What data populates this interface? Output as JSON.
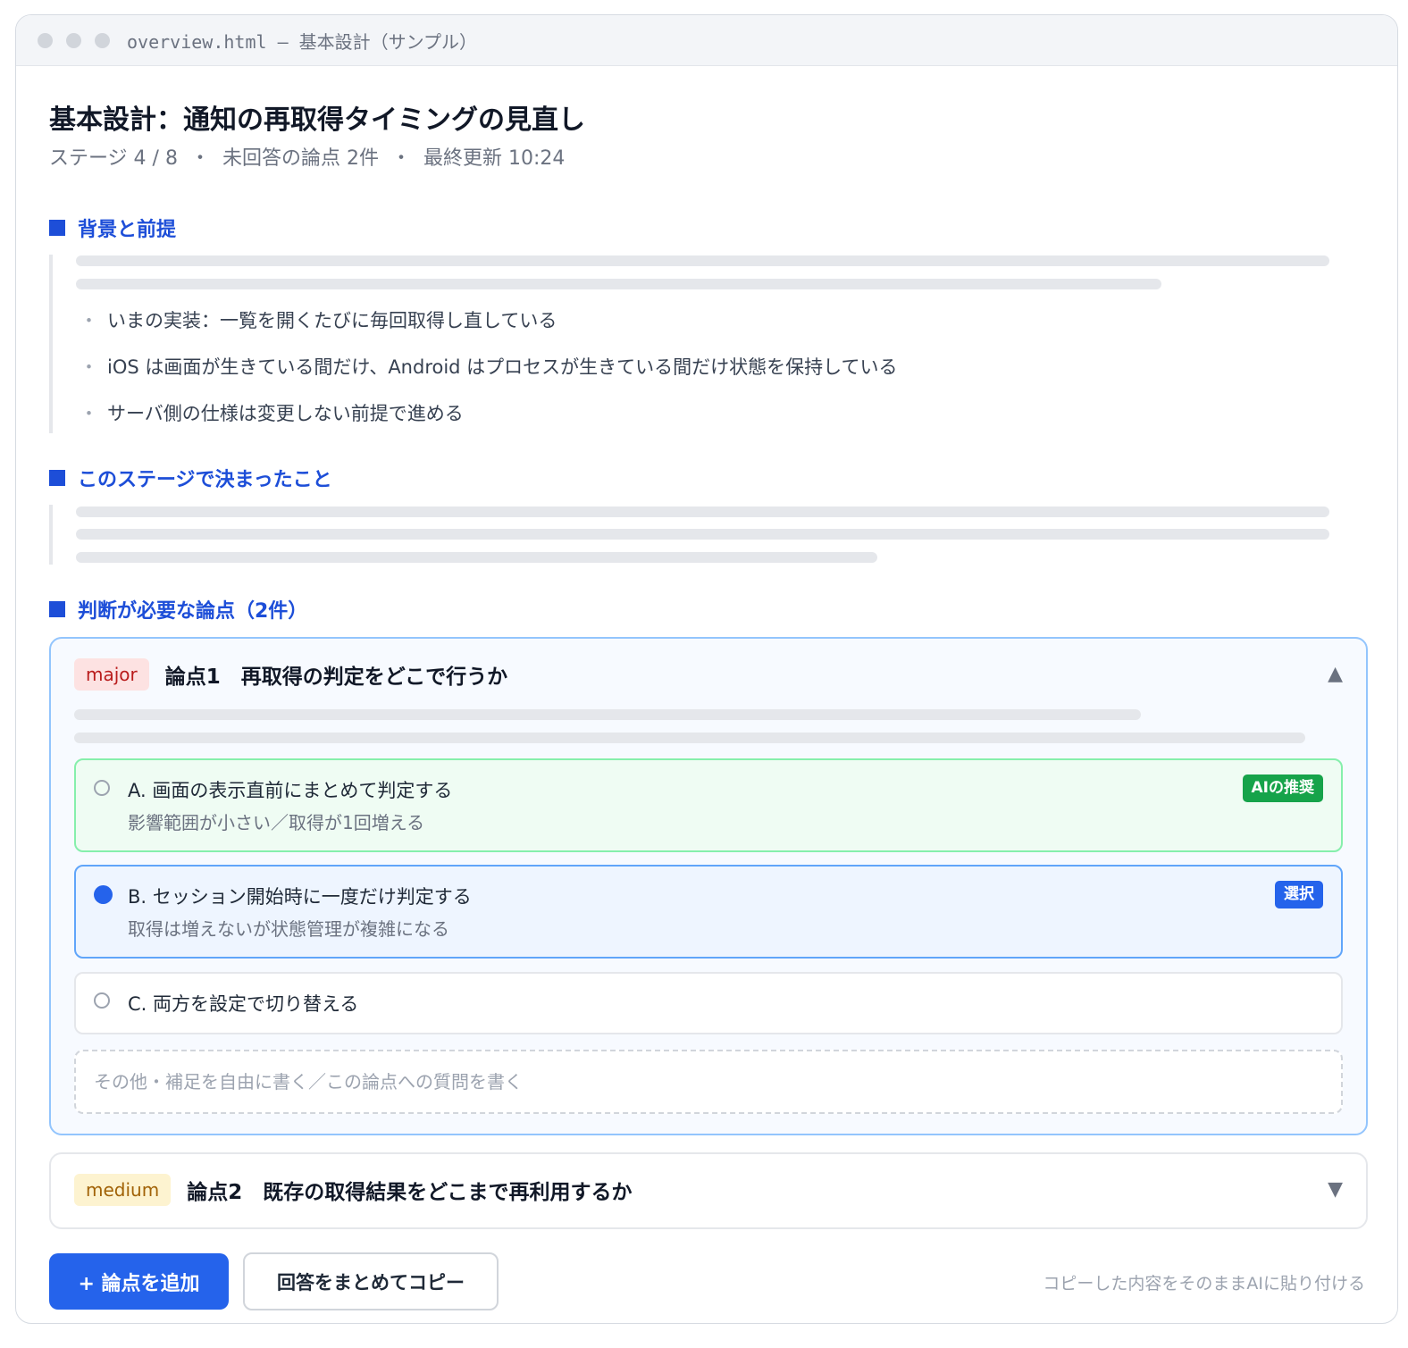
{
  "window": {
    "title": "overview.html — 基本設計（サンプル）"
  },
  "page": {
    "title": "基本設計：通知の再取得タイミングの見直し",
    "meta": {
      "stage": "ステージ 4 / 8",
      "open_issues": "未回答の論点 2件",
      "updated": "最終更新 10:24",
      "separator": "・"
    }
  },
  "sections": {
    "background": {
      "heading": "背景と前提",
      "bullet_mark": "・",
      "bullets": [
        "いまの実装：一覧を開くたびに毎回取得し直している",
        "iOS は画面が生きている間だけ、Android はプロセスが生きている間だけ状態を保持している",
        "サーバ側の仕様は変更しない前提で進める"
      ]
    },
    "decided": {
      "heading": "このステージで決まったこと"
    },
    "issues": {
      "heading": "判断が必要な論点（2件）"
    }
  },
  "issues": [
    {
      "severity": "major",
      "title": "論点1　再取得の判定をどこで行うか",
      "expanded": true,
      "caret": "▲",
      "options": [
        {
          "label": "A. 画面の表示直前にまとめて判定する",
          "sub": "影響範囲が小さい／取得が1回増える",
          "tag": "AIの推奨",
          "selected": false
        },
        {
          "label": "B. セッション開始時に一度だけ判定する",
          "sub": "取得は増えないが状態管理が複雑になる",
          "tag": "選択",
          "selected": true
        },
        {
          "label": "C. 両方を設定で切り替える",
          "selected": false
        }
      ],
      "free_text": {
        "value": "",
        "placeholder": "その他・補足を自由に書く／この論点への質問を書く"
      }
    },
    {
      "severity": "medium",
      "title": "論点2　既存の取得結果をどこまで再利用するか",
      "expanded": false,
      "caret": "▼"
    }
  ],
  "actions": {
    "add_issue": "+ 論点を追加",
    "copy_answers": "回答をまとめてコピー",
    "hint": "コピーした内容をそのままAIに貼り付ける"
  },
  "colors": {
    "accent": "#2563eb",
    "heading": "#1d4ed8",
    "major_badge": "#fde2e2",
    "medium_badge": "#fdf3d0",
    "recommended": "#16a34a"
  },
  "icons": {
    "window_dots": "traffic-light-dots",
    "collapse": "triangle-up",
    "expand": "triangle-down"
  }
}
